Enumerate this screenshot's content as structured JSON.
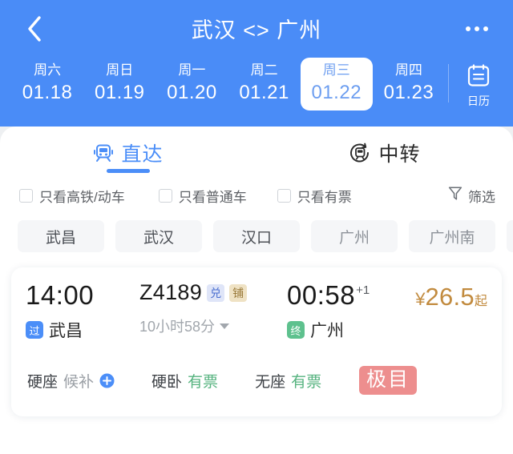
{
  "header": {
    "back_icon": "chevron-left-icon",
    "title": "武汉 <> 广州",
    "more_icon": "more-options-icon",
    "dates": [
      {
        "weekday": "周六",
        "date": "01.18",
        "selected": false
      },
      {
        "weekday": "周日",
        "date": "01.19",
        "selected": false
      },
      {
        "weekday": "周一",
        "date": "01.20",
        "selected": false
      },
      {
        "weekday": "周二",
        "date": "01.21",
        "selected": false
      },
      {
        "weekday": "周三",
        "date": "01.22",
        "selected": true
      },
      {
        "weekday": "周四",
        "date": "01.23",
        "selected": false
      }
    ],
    "calendar": {
      "icon": "calendar-icon",
      "label": "日历"
    },
    "bg_color": "#4a8cf7"
  },
  "tabs": [
    {
      "label": "直达",
      "icon": "train-front-icon",
      "active": true
    },
    {
      "label": "中转",
      "icon": "transfer-train-icon",
      "active": false
    }
  ],
  "filters": {
    "checkboxes": [
      {
        "label": "只看高铁/动车",
        "checked": false
      },
      {
        "label": "只看普通车",
        "checked": false
      },
      {
        "label": "只看有票",
        "checked": false
      }
    ],
    "filter_button": {
      "label": "筛选",
      "icon": "funnel-icon"
    }
  },
  "stations": [
    {
      "label": "武昌",
      "muted": false
    },
    {
      "label": "武汉",
      "muted": false
    },
    {
      "label": "汉口",
      "muted": false
    },
    {
      "label": "广州",
      "muted": true
    },
    {
      "label": "广州南",
      "muted": true
    },
    {
      "label": "",
      "muted": true,
      "partial": true
    }
  ],
  "train": {
    "depart_time": "14:00",
    "depart_badge": "过",
    "depart_station": "武昌",
    "train_no": "Z4189",
    "train_tags": [
      {
        "label": "兑",
        "style": "blue"
      },
      {
        "label": "铺",
        "style": "tan"
      }
    ],
    "duration": "10小时58分",
    "duration_caret": "chevron-down-icon",
    "arrive_time": "00:58",
    "arrive_day_offset": "+1",
    "arrive_badge": "终",
    "arrive_station": "广州",
    "price_symbol": "¥",
    "price_amount": "26.5",
    "price_suffix": "起",
    "price_color": "#c28b3f",
    "seats": [
      {
        "name": "硬座",
        "value": "候补",
        "state": "gray",
        "has_plus": true
      },
      {
        "name": "硬卧",
        "value": "有票",
        "state": "green",
        "has_plus": false
      },
      {
        "name": "无座",
        "value": "有票",
        "state": "green",
        "has_plus": false
      }
    ],
    "watermark": "极目"
  }
}
